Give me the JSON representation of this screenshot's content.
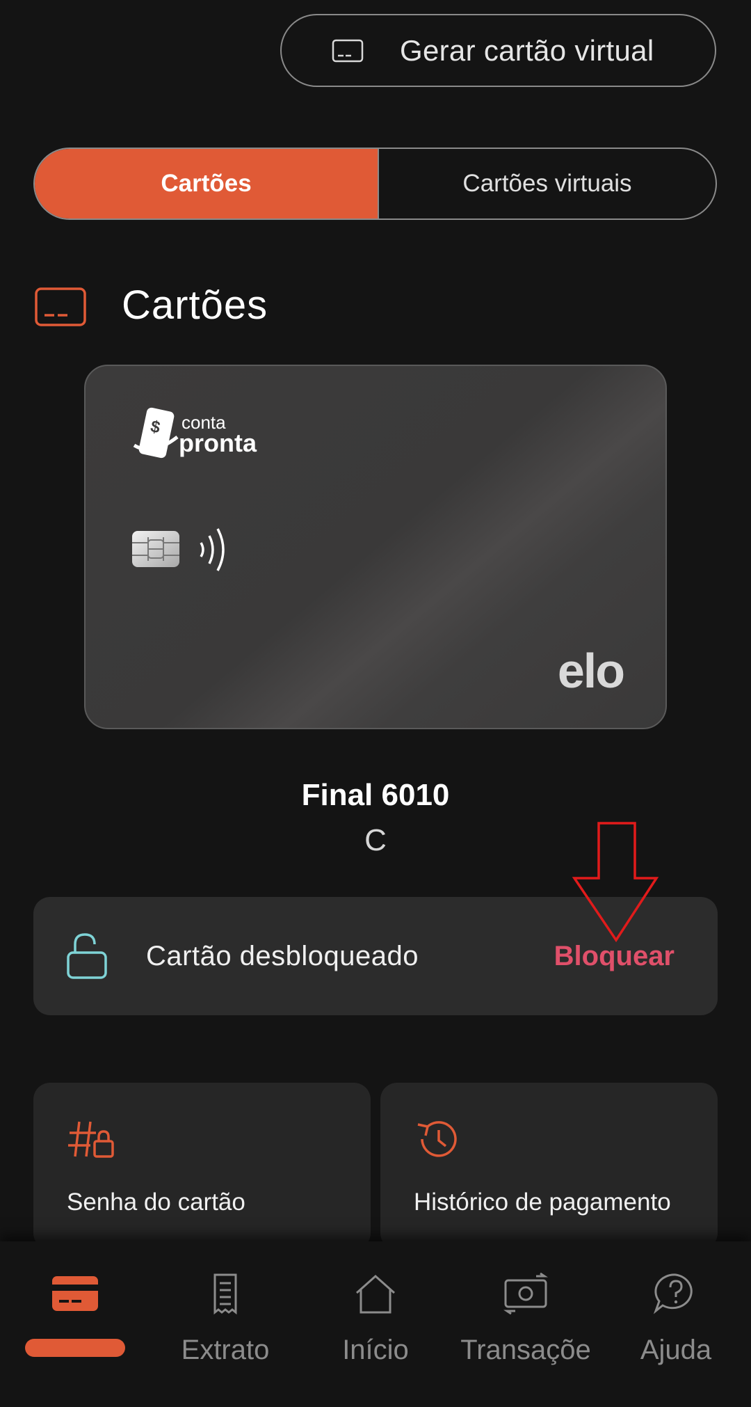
{
  "header": {
    "generate_virtual_label": "Gerar cartão virtual",
    "icon": "card-outline-icon"
  },
  "tabs": [
    {
      "label": "Cartões",
      "active": true
    },
    {
      "label": "Cartões virtuais",
      "active": false
    }
  ],
  "section": {
    "title": "Cartões",
    "icon": "card-outline-icon"
  },
  "card": {
    "issuer_logo_top": "conta",
    "issuer_logo_bottom": "pronta",
    "brand": "elo",
    "final_label": "Final 6010",
    "holder_initial": "C"
  },
  "status": {
    "text": "Cartão desbloqueado",
    "action_label": "Bloquear",
    "icon": "unlock-icon"
  },
  "options": [
    {
      "label": "Senha do cartão",
      "icon": "hash-lock-icon"
    },
    {
      "label": "Histórico de pagamento",
      "icon": "history-icon"
    }
  ],
  "bottom_nav": [
    {
      "label": "",
      "icon": "card-icon",
      "active": true
    },
    {
      "label": "Extrato",
      "icon": "receipt-icon",
      "active": false
    },
    {
      "label": "Início",
      "icon": "home-icon",
      "active": false
    },
    {
      "label": "Transaçõe",
      "icon": "money-exchange-icon",
      "active": false
    },
    {
      "label": "Ajuda",
      "icon": "help-icon",
      "active": false
    }
  ],
  "colors": {
    "accent": "#e05a36",
    "danger": "#e0506a",
    "unlock_icon": "#7fd3d6",
    "background": "#141414"
  }
}
